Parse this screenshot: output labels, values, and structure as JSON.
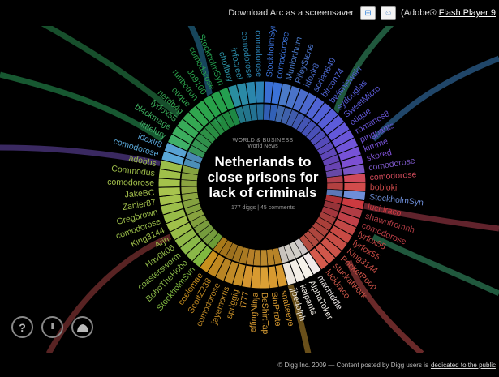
{
  "topbar": {
    "download_text": "Download Arc as a screensaver",
    "adobe_prefix": "(Adobe®",
    "flash_link": "Flash Player 9"
  },
  "story": {
    "category": "WORLD & BUSINESS",
    "subcategory": "World News",
    "title": "Netherlands to close prisons for lack of criminals",
    "diggs": "177 diggs",
    "comments": "45 comments"
  },
  "users": [
    {
      "name": "StockholmSyn",
      "color": "#3a6fd4"
    },
    {
      "name": "comodorose",
      "color": "#3b72d8"
    },
    {
      "name": "Munionhum",
      "color": "#4a7ac8"
    },
    {
      "name": "RileyStene",
      "color": "#4a73c9"
    },
    {
      "name": "idoxlr8",
      "color": "#4a6ccb"
    },
    {
      "name": "sorian649",
      "color": "#4c69cf"
    },
    {
      "name": "bircon74",
      "color": "#5064d4"
    },
    {
      "name": "bwisniewski",
      "color": "#5160d6"
    },
    {
      "name": "sydouglas",
      "color": "#565ed8"
    },
    {
      "name": "SweetMicro",
      "color": "#5c5bd9"
    },
    {
      "name": "otique",
      "color": "#6358da"
    },
    {
      "name": "romanos8",
      "color": "#6a56da"
    },
    {
      "name": "pingpants",
      "color": "#7054d9"
    },
    {
      "name": "kimme",
      "color": "#7652d6"
    },
    {
      "name": "skored",
      "color": "#7c4fd2"
    },
    {
      "name": "comodorose",
      "color": "#7a56c4"
    },
    {
      "name": "comodorose",
      "color": "#d04a5a"
    },
    {
      "name": "bobloki",
      "color": "#d24c4c"
    },
    {
      "name": "StockholmSyn",
      "color": "#6e8ed8"
    },
    {
      "name": "lucidraco",
      "color": "#cc3a40"
    },
    {
      "name": "shawnfromnh",
      "color": "#b03c44"
    },
    {
      "name": "comodorose",
      "color": "#c04048"
    },
    {
      "name": "fyrfox55",
      "color": "#c24846"
    },
    {
      "name": "fyrfox55",
      "color": "#c84a44"
    },
    {
      "name": "King3144",
      "color": "#c84e46"
    },
    {
      "name": "PocketPoop",
      "color": "#cc5248"
    },
    {
      "name": "stuckatwork",
      "color": "#d0564a"
    },
    {
      "name": "lucidraco",
      "color": "#d45a4c"
    },
    {
      "name": "machiddle",
      "color": "#f0eaea"
    },
    {
      "name": "AlphaToker",
      "color": "#f6f2ea"
    },
    {
      "name": "kalpants",
      "color": "#f3eee6"
    },
    {
      "name": "jjbedolph",
      "color": "#ece6de"
    },
    {
      "name": "snakeeye",
      "color": "#d89a30"
    },
    {
      "name": "BioPirate",
      "color": "#d89a30"
    },
    {
      "name": "BeShirtTap",
      "color": "#dba035"
    },
    {
      "name": "effingNinja",
      "color": "#d89a30"
    },
    {
      "name": "f777",
      "color": "#d59630"
    },
    {
      "name": "spriggig",
      "color": "#c89028"
    },
    {
      "name": "jayemorris",
      "color": "#c08a26"
    },
    {
      "name": "comodorose",
      "color": "#b88424"
    },
    {
      "name": "ScottZ238",
      "color": "#c08820"
    },
    {
      "name": "coelomae",
      "color": "#c8901e"
    },
    {
      "name": "StockholmSyn",
      "color": "#80b840"
    },
    {
      "name": "BoboTheHobo",
      "color": "#8ab848"
    },
    {
      "name": "coastersworm",
      "color": "#8ab848"
    },
    {
      "name": "Hav0k06",
      "color": "#90b848"
    },
    {
      "name": "Arjn",
      "color": "#98bb48"
    },
    {
      "name": "King3144",
      "color": "#a0c04a"
    },
    {
      "name": "comodorose",
      "color": "#98bc48"
    },
    {
      "name": "Gregbrown",
      "color": "#9cbe4a"
    },
    {
      "name": "Zanier87",
      "color": "#a4c24c"
    },
    {
      "name": "JakeBC",
      "color": "#a8c44e"
    },
    {
      "name": "comodorose",
      "color": "#a4c24c"
    },
    {
      "name": "Commodus",
      "color": "#a0c04a"
    },
    {
      "name": "adobbs",
      "color": "#9cbe4a"
    },
    {
      "name": "comodorose",
      "color": "#5aa8d8"
    },
    {
      "name": "idoxlr8",
      "color": "#58a2d4"
    },
    {
      "name": "littlelury",
      "color": "#40b068"
    },
    {
      "name": "bl4ckmage",
      "color": "#3cae5e"
    },
    {
      "name": "fyrfox55",
      "color": "#38aa58"
    },
    {
      "name": "nerdb4g",
      "color": "#34a852"
    },
    {
      "name": "otique",
      "color": "#30a64e"
    },
    {
      "name": "runbotrun",
      "color": "#2ca44c"
    },
    {
      "name": "Jo9100",
      "color": "#28a24a"
    },
    {
      "name": "comodorose",
      "color": "#26a04a"
    },
    {
      "name": "StockholmSyn",
      "color": "#24a050"
    },
    {
      "name": "chollboy",
      "color": "#2a8ea0"
    },
    {
      "name": "infocreel",
      "color": "#2a8aa6"
    },
    {
      "name": "comodorose",
      "color": "#2a86ac"
    },
    {
      "name": "comodorose",
      "color": "#2c80b4"
    }
  ],
  "controls": {
    "help_label": "?",
    "pause_label": "II",
    "digg_label": "digg"
  },
  "footer": {
    "text": "© Digg Inc. 2009 — Content posted by Digg users is",
    "link": "dedicated to the public"
  }
}
